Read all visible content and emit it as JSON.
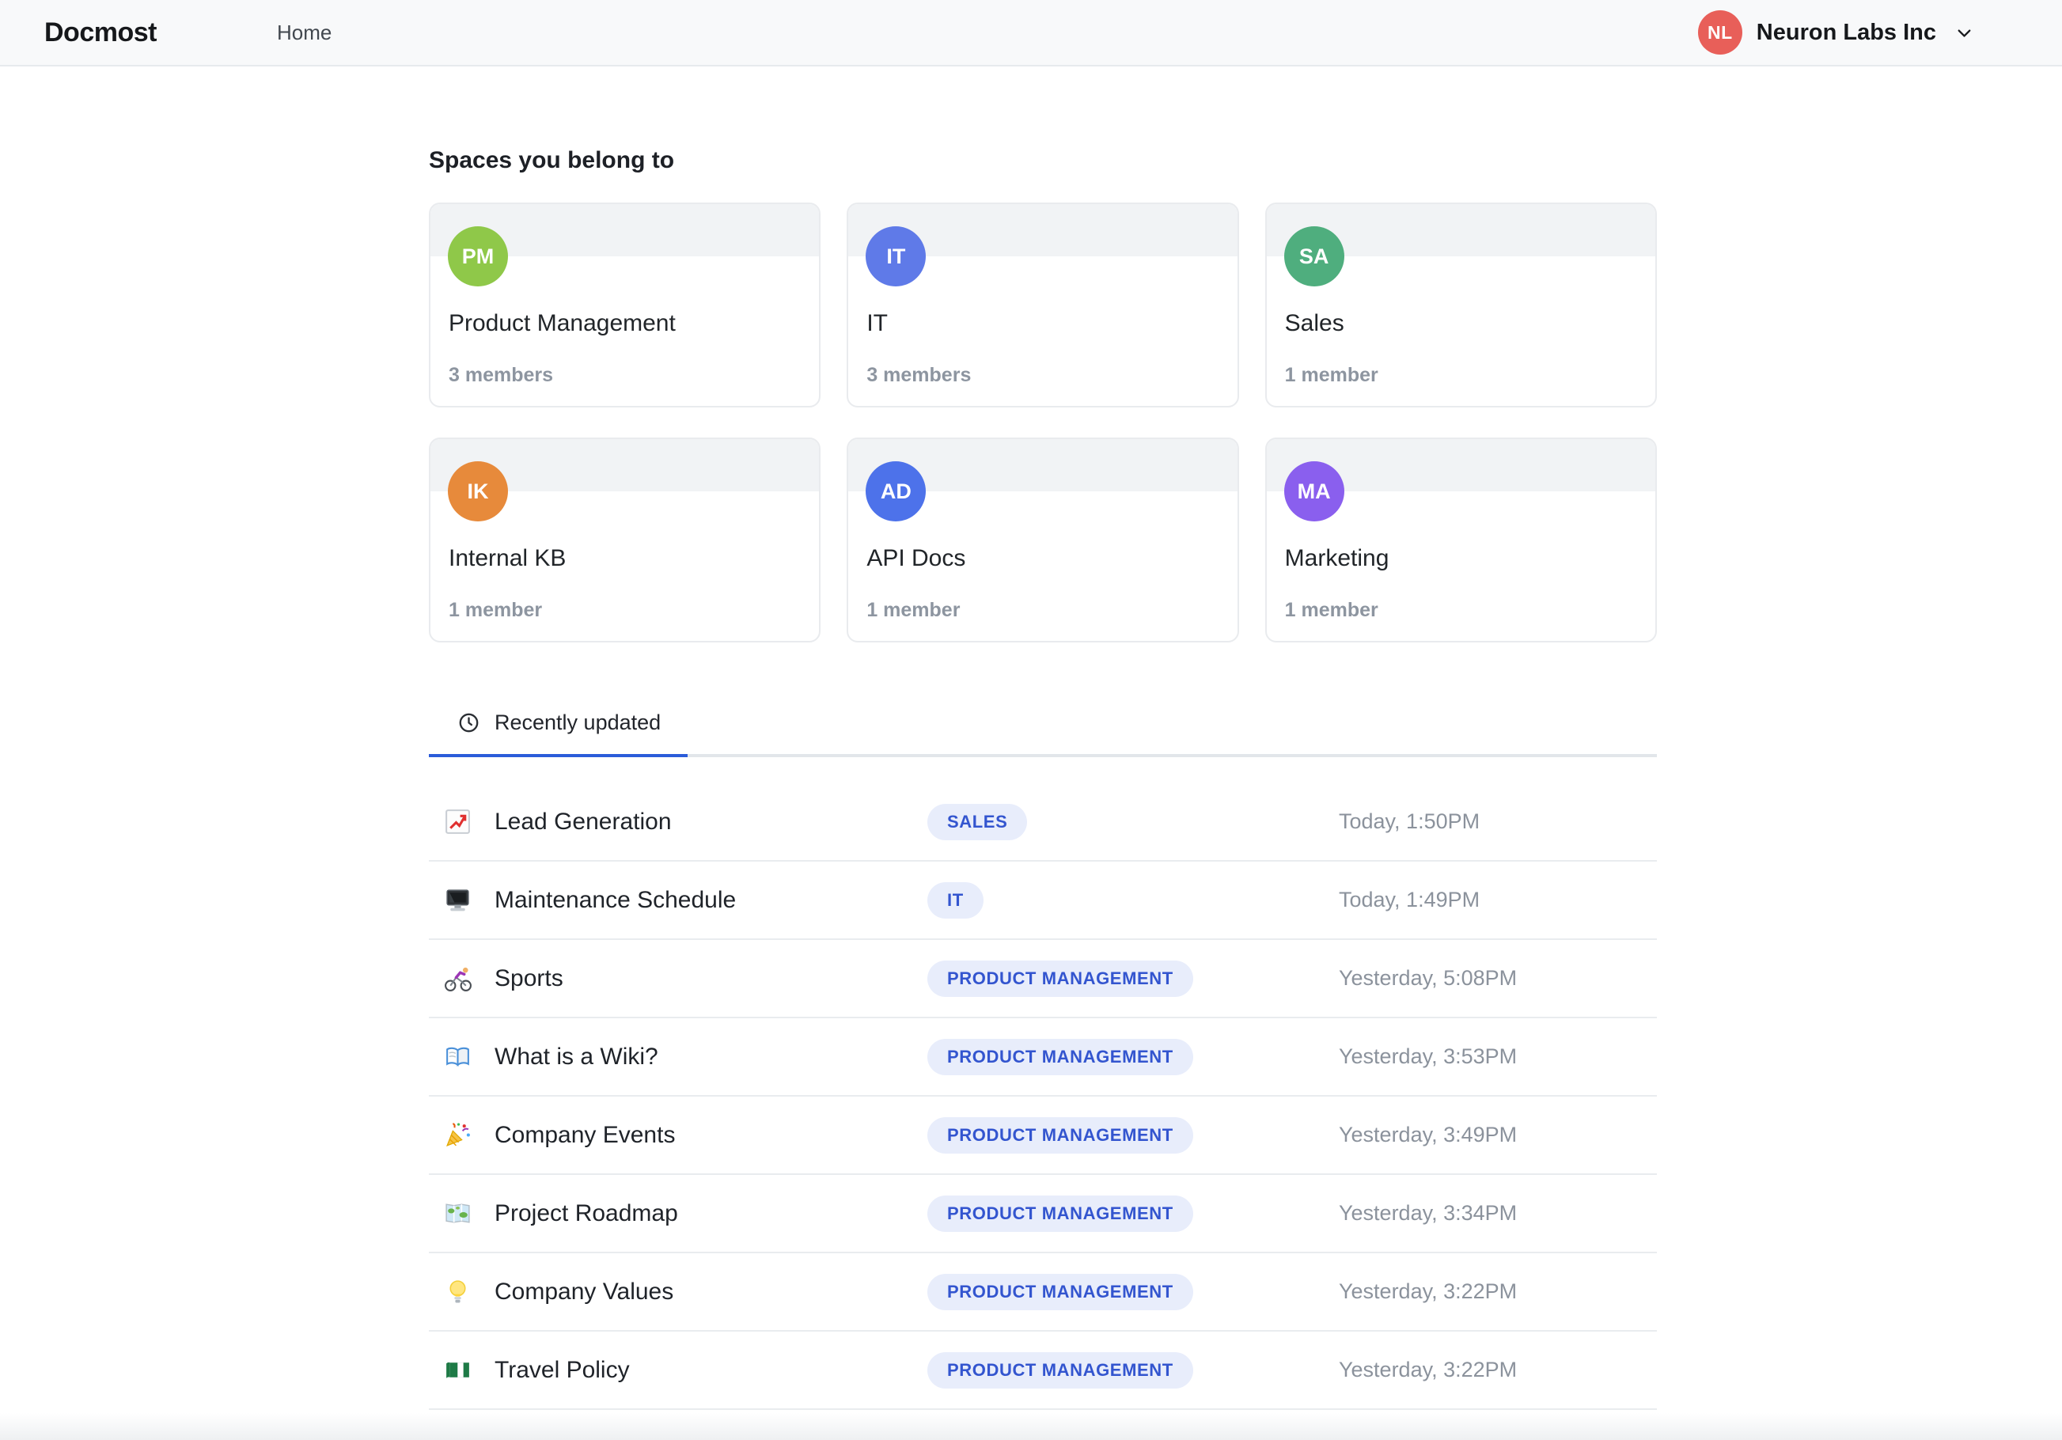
{
  "header": {
    "logo": "Docmost",
    "nav_home": "Home",
    "workspace": {
      "initials": "NL",
      "name": "Neuron Labs Inc",
      "avatar_color": "#e85f59"
    }
  },
  "spaces": {
    "heading": "Spaces you belong to",
    "cards": [
      {
        "initials": "PM",
        "name": "Product Management",
        "members": "3 members",
        "color": "#8fc849"
      },
      {
        "initials": "IT",
        "name": "IT",
        "members": "3 members",
        "color": "#5f7ae8"
      },
      {
        "initials": "SA",
        "name": "Sales",
        "members": "1 member",
        "color": "#4fae7e"
      },
      {
        "initials": "IK",
        "name": "Internal KB",
        "members": "1 member",
        "color": "#e78a3b"
      },
      {
        "initials": "AD",
        "name": "API Docs",
        "members": "1 member",
        "color": "#4d72ea"
      },
      {
        "initials": "MA",
        "name": "Marketing",
        "members": "1 member",
        "color": "#8a5fee"
      }
    ]
  },
  "recent": {
    "tab_label": "Recently updated",
    "rows": [
      {
        "icon": "chart-increasing-icon",
        "title": "Lead Generation",
        "badge": "SALES",
        "time": "Today, 1:50PM"
      },
      {
        "icon": "desktop-computer-icon",
        "title": "Maintenance Schedule",
        "badge": "IT",
        "time": "Today, 1:49PM"
      },
      {
        "icon": "person-biking-icon",
        "title": "Sports",
        "badge": "PRODUCT MANAGEMENT",
        "time": "Yesterday, 5:08PM"
      },
      {
        "icon": "open-book-icon",
        "title": "What is a Wiki?",
        "badge": "PRODUCT MANAGEMENT",
        "time": "Yesterday, 3:53PM"
      },
      {
        "icon": "party-popper-icon",
        "title": "Company Events",
        "badge": "PRODUCT MANAGEMENT",
        "time": "Yesterday, 3:49PM"
      },
      {
        "icon": "world-map-icon",
        "title": "Project Roadmap",
        "badge": "PRODUCT MANAGEMENT",
        "time": "Yesterday, 3:34PM"
      },
      {
        "icon": "light-bulb-icon",
        "title": "Company Values",
        "badge": "PRODUCT MANAGEMENT",
        "time": "Yesterday, 3:22PM"
      },
      {
        "icon": "nigeria-flag-icon",
        "title": "Travel Policy",
        "badge": "PRODUCT MANAGEMENT",
        "time": "Yesterday, 3:22PM"
      }
    ]
  },
  "colors": {
    "accent_blue": "#2b5cd9",
    "badge_bg": "#e8edfb",
    "badge_text": "#3355cf",
    "header_bg": "#f8f9fa"
  }
}
